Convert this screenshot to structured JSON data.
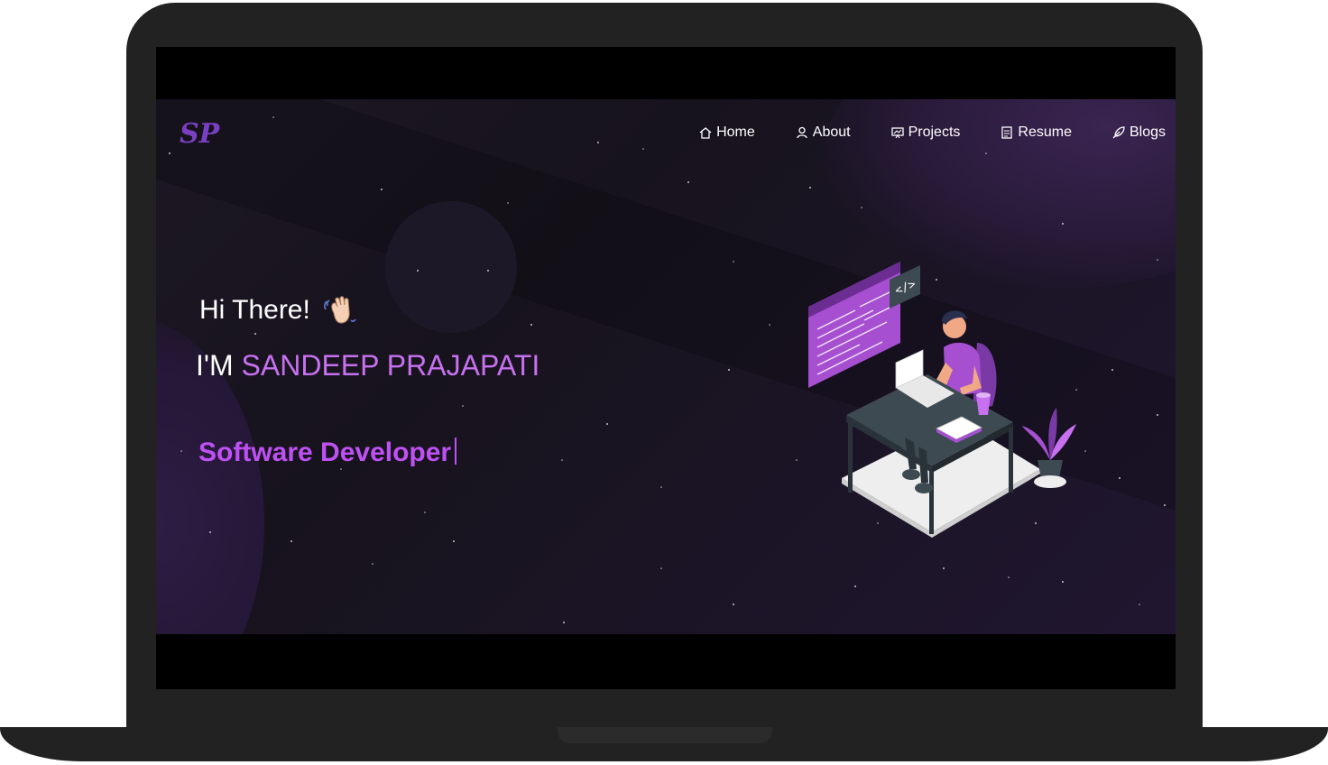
{
  "logo": {
    "text": "SP"
  },
  "nav": {
    "items": [
      {
        "label": "Home",
        "icon": "home-icon"
      },
      {
        "label": "About",
        "icon": "user-icon"
      },
      {
        "label": "Projects",
        "icon": "projects-icon"
      },
      {
        "label": "Resume",
        "icon": "document-icon"
      },
      {
        "label": "Blogs",
        "icon": "feather-icon"
      }
    ]
  },
  "hero": {
    "greeting": "Hi There!",
    "intro_prefix": "I'M",
    "name": "SANDEEP PRAJAPATI",
    "role": "Software Developer"
  },
  "colors": {
    "accent": "#c770f0",
    "role": "#be50f4",
    "background": "#1c1724",
    "laptop_frame": "#222222"
  }
}
